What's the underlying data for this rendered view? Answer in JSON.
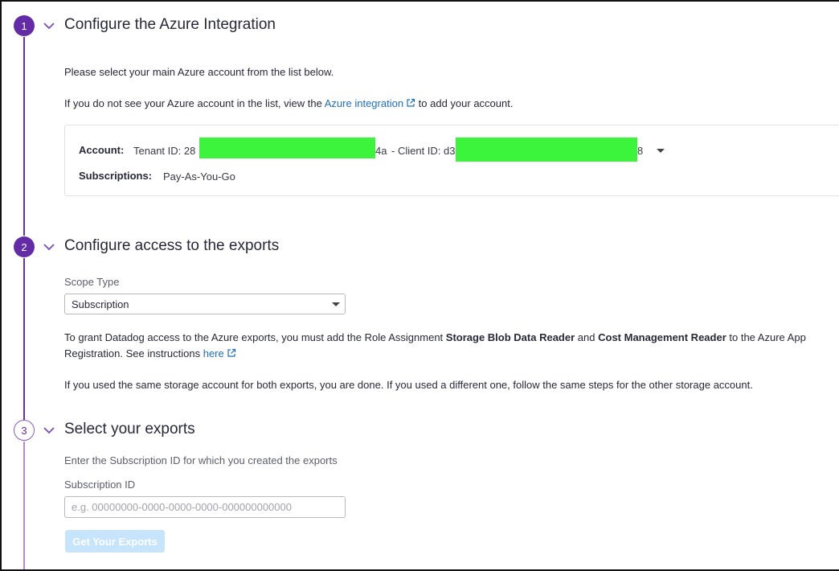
{
  "steps": [
    {
      "number": "1",
      "title": "Configure the Azure Integration"
    },
    {
      "number": "2",
      "title": "Configure access to the exports"
    },
    {
      "number": "3",
      "title": "Select your exports"
    }
  ],
  "step1": {
    "intro": "Please select your main Azure account from the list below.",
    "missing_prefix": "If you do not see your Azure account in the list, view the",
    "azure_link": "Azure integration",
    "missing_suffix": "to add your account.",
    "account_label": "Account:",
    "tenant_prefix": "Tenant ID: 28",
    "tenant_suffix": "4a",
    "client_prefix": "- Client ID: d3",
    "client_suffix": "8",
    "subscriptions_label": "Subscriptions:",
    "subscriptions_value": "Pay-As-You-Go"
  },
  "step2": {
    "scope_label": "Scope Type",
    "scope_value": "Subscription",
    "grant_part1": "To grant Datadog access to the Azure exports, you must add the Role Assignment",
    "role_storage": "Storage Blob Data Reader",
    "grant_and": "and",
    "role_cost": "Cost Management Reader",
    "grant_part2": "to the Azure App",
    "grant_line2": "Registration. See instructions",
    "instructions_link": "here",
    "same_storage": "If you used the same storage account for both exports, you are done. If you used a different one, follow the same steps for the other storage account."
  },
  "step3": {
    "intro": "Enter the Subscription ID for which you created the exports",
    "subscription_label": "Subscription ID",
    "subscription_placeholder": "e.g. 00000000-0000-0000-0000-000000000000",
    "get_exports_label": "Get Your Exports"
  },
  "colors": {
    "step_purple": "#632ca6",
    "link_blue": "#1f6fb8",
    "redaction_green": "#3cf43c",
    "disabled_button": "#c6e4fb"
  }
}
